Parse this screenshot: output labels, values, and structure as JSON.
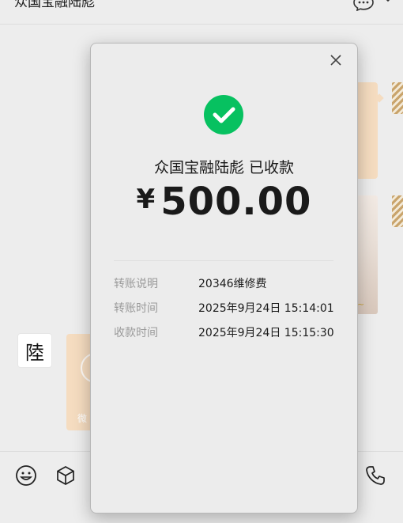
{
  "chat": {
    "title": "众国宝融陆彪",
    "avatar_glyph": "陸",
    "bubble_text": "微"
  },
  "modal": {
    "status": "众国宝融陆彪 已收款",
    "currency": "¥",
    "amount": "500.00",
    "details": [
      {
        "label": "转账说明",
        "value": "20346维修费"
      },
      {
        "label": "转账时间",
        "value": "2025年9月24日 15:14:01"
      },
      {
        "label": "收款时间",
        "value": "2025年9月24日 15:15:30"
      }
    ]
  },
  "colors": {
    "success": "#07c160",
    "bubble": "#f5dcc0"
  },
  "icons": [
    "close-icon",
    "check-icon",
    "chat-bubble-icon",
    "chevron-down-icon",
    "emoji-icon",
    "cube-icon",
    "phone-icon"
  ]
}
